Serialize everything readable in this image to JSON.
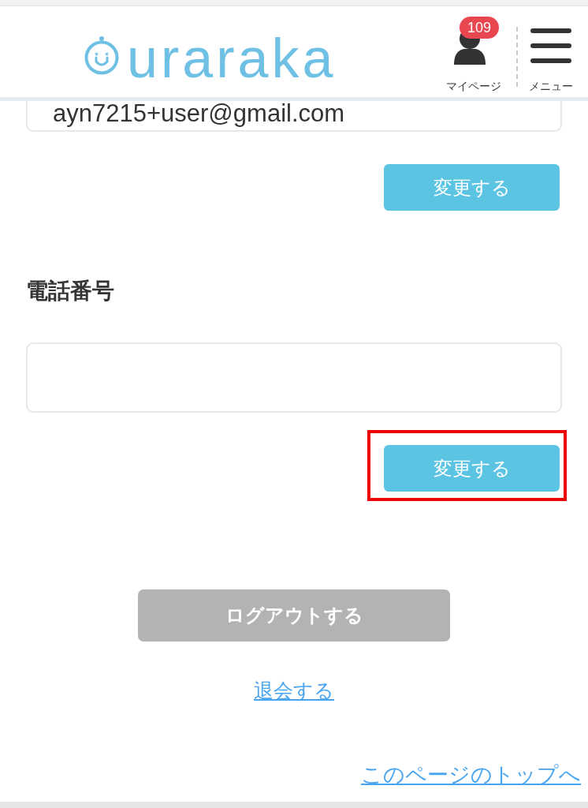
{
  "header": {
    "logo": {
      "text": "uraraka"
    },
    "mypage": {
      "label": "マイページ",
      "badge": "109"
    },
    "menu": {
      "label": "メニュー"
    }
  },
  "email_section": {
    "field": {
      "value": "ayn7215+user@gmail.com"
    },
    "button": {
      "label": "変更する",
      "highlighted": false
    }
  },
  "phone_section": {
    "heading": "電話番号",
    "button": {
      "label": "変更する",
      "highlighted": true
    }
  },
  "logout_button": {
    "label": "ログアウトする"
  },
  "withdraw_link": {
    "label": "退会する"
  },
  "page_top_link": {
    "label": "このページのトップへ"
  }
}
